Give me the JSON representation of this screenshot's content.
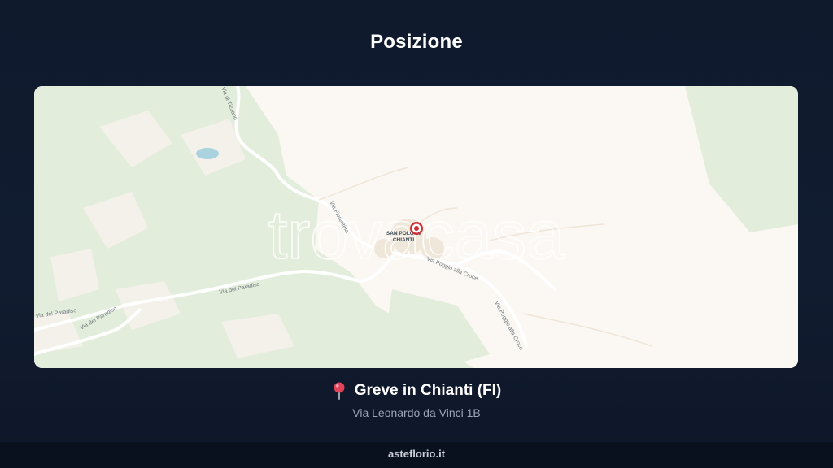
{
  "header": {
    "title": "Posizione"
  },
  "map": {
    "place_label": [
      "SAN POLO IN",
      "CHIANTI"
    ],
    "road_labels": {
      "via_fiorentina": "Via Fiorentina",
      "via_poggio_1": "Via Poggio alla Croce",
      "via_poggio_2": "Via Poggio alla Croce",
      "via_paradiso": "Via del Paradiso",
      "via_paradiso_w1": "Via del Paradiso",
      "via_paradiso_w2": "Via del Paradiso",
      "via_top": "Via di Tizzano"
    },
    "watermark": "trovacasa",
    "colors": {
      "land": "#fbf7f2",
      "green": "#e3eddb",
      "road": "#ffffff",
      "water": "#aad3df",
      "marker": "#c8303a"
    }
  },
  "location": {
    "pin_icon": "round-pushpin-icon",
    "city": "Greve in Chianti (FI)",
    "address": "Via Leonardo da Vinci 1B"
  },
  "footer": {
    "site": "asteflorio.it"
  }
}
